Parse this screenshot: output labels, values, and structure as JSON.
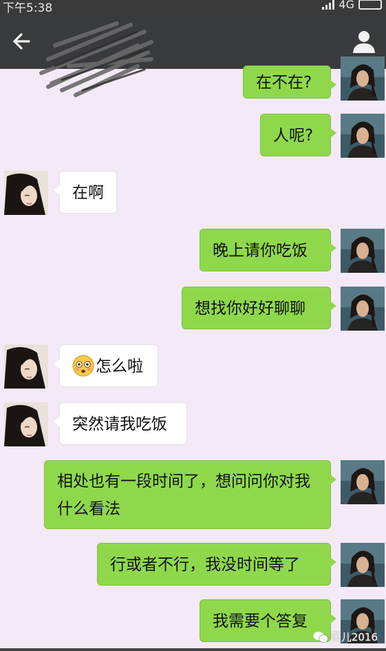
{
  "status": {
    "time": "下午5:38",
    "network": "4G"
  },
  "navbar": {
    "back_icon": "back-arrow-icon",
    "profile_icon": "person-icon"
  },
  "messages": [
    {
      "side": "right",
      "text": "在不在?"
    },
    {
      "side": "right",
      "text": "人呢?"
    },
    {
      "side": "left",
      "text": "在啊"
    },
    {
      "side": "right",
      "text": "晚上请你吃饭"
    },
    {
      "side": "right",
      "text": "想找你好好聊聊"
    },
    {
      "side": "left",
      "emoji": "flushed-face-emoji",
      "text": "怎么啦"
    },
    {
      "side": "left",
      "text": "突然请我吃饭"
    },
    {
      "side": "right",
      "text": "相处也有一段时间了，想问问你对我什么看法"
    },
    {
      "side": "right",
      "text": "行或者不行，我没时间等了"
    },
    {
      "side": "right",
      "text": "我需要个答复"
    }
  ],
  "watermark": {
    "text": "萧儿2016"
  },
  "colors": {
    "bubble_right": "#8fd84c",
    "bubble_left": "#ffffff",
    "background": "#f4e9f6",
    "navbar": "#393a3e"
  }
}
